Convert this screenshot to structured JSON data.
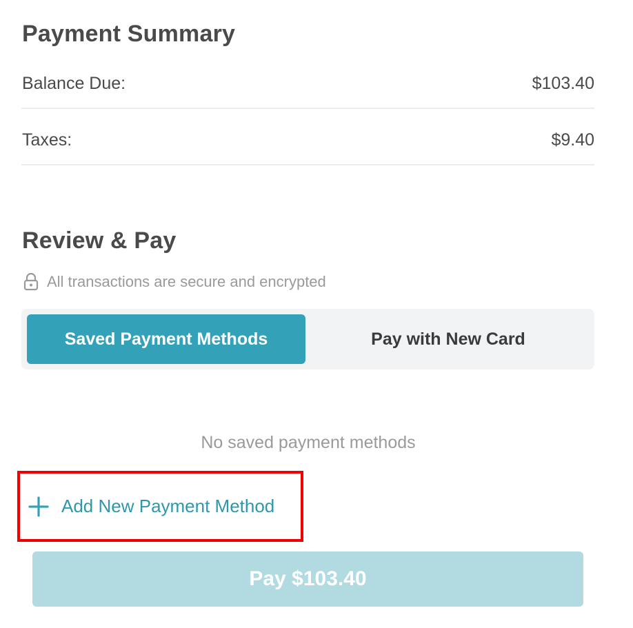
{
  "summary": {
    "title": "Payment Summary",
    "rows": [
      {
        "label": "Balance Due:",
        "value": "$103.40"
      },
      {
        "label": "Taxes:",
        "value": "$9.40"
      }
    ]
  },
  "review": {
    "title": "Review & Pay",
    "secure_note": "All transactions are secure and encrypted",
    "secure_icon": "lock-icon"
  },
  "tabs": [
    {
      "label": "Saved Payment Methods",
      "active": true
    },
    {
      "label": "Pay with New Card",
      "active": false
    }
  ],
  "saved_methods": {
    "empty_text": "No saved payment methods",
    "add_label": "Add New Payment Method",
    "add_icon": "plus-icon"
  },
  "pay_button": {
    "label": "Pay $103.40"
  },
  "colors": {
    "accent": "#33a1b8",
    "accent_text": "#2f97ad",
    "pay_button_disabled": "#b1dbe1",
    "highlight_border": "#f20000",
    "muted_text": "#9a9a9a",
    "tab_track": "#f2f3f5"
  }
}
